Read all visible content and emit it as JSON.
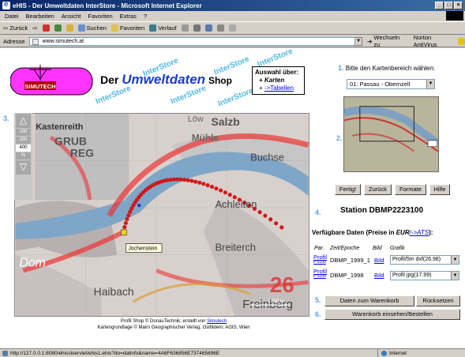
{
  "window": {
    "title": "eHIS - Der Umweltdaten InterStore - Microsoft Internet Explorer"
  },
  "menu": [
    "Datei",
    "Bearbeiten",
    "Ansicht",
    "Favoriten",
    "Extras",
    "?"
  ],
  "toolbar": {
    "back": "Zurück",
    "search": "Suchen",
    "favorites": "Favoriten",
    "history": "Verlauf"
  },
  "address": {
    "label": "Adresse",
    "url": "www.simutech.at",
    "goto": "Wechseln zu",
    "norton": "Norton AntiVirus"
  },
  "header": {
    "logo_text": "SIMUTECH",
    "title_der": "Der",
    "title_um": "Umweltdaten",
    "title_shop": "Shop",
    "watermark": "InterStore",
    "auswahl_title": "Auswahl über:",
    "auswahl_karten": "+ Karten",
    "auswahl_tabellen_prefix": "+ ",
    "auswahl_tabellen": "->Tabellen"
  },
  "map": {
    "step": "3.",
    "zoom_levels": [
      "100",
      "200",
      "400"
    ],
    "zoom_unit": "%",
    "labels": [
      "Kastenreith",
      "GRUB",
      "REG",
      "Salzb",
      "Mühle",
      "Buchse",
      "Achleiten",
      "Jochenstein",
      "Breiterch",
      "Dom",
      "Haibach",
      "Freinberg",
      "Löw"
    ],
    "scale": "1000 m",
    "number_label": "26",
    "tooltip": "Jochenstein",
    "credit_line1_prefix": "Profil Shop © DonauTechnik; erstellt von ",
    "credit_link": "Simutech",
    "credit_line2": "Kartengrundlage © Mairs Geographischer Verlag, Ostfildern; AGIS, Wien"
  },
  "panel": {
    "step1": "1.",
    "step1_text": "Bitte den Kartenbereich wählen:",
    "region": "01: Passau - Obernzell",
    "step2": "2.",
    "buttons": [
      "Fertig!",
      "Zurück",
      "Formate",
      "Hilfe"
    ],
    "step4": "4.",
    "station_label": "Station",
    "station_id": "DBMP2223100",
    "verf_text": "Verfügbare Daten (Preise in ",
    "verf_eur": "EUR",
    "verf_ats": "/->ATS",
    "verf_end": "):",
    "headers": [
      "Par.",
      "Zeit/Epoche",
      "Bild",
      "Grafik"
    ],
    "rows": [
      {
        "par": "Profil",
        "code": "P 5100",
        "epoch": "DBMP_1999_1",
        "bild": "Bild",
        "grafik": "Profil/5m dxf(26.98)"
      },
      {
        "par": "Profil",
        "code": "P 5100",
        "epoch": "DBMP_1998",
        "bild": "Bild",
        "grafik": "Profil jpg(17.99)"
      }
    ],
    "step5": "5.",
    "cart_button": "Daten zum Warenkorb",
    "reset_button": "Rücksetzen",
    "step6": "6.",
    "order_button": "Warenkorb einsehen/Bestellen"
  },
  "status": {
    "url": "http://127.0.0.1:8080/ehisslservlet/ehis1.ehis?do=datinfo&name=4A6F636856E737465696E",
    "zone": "Internet"
  }
}
